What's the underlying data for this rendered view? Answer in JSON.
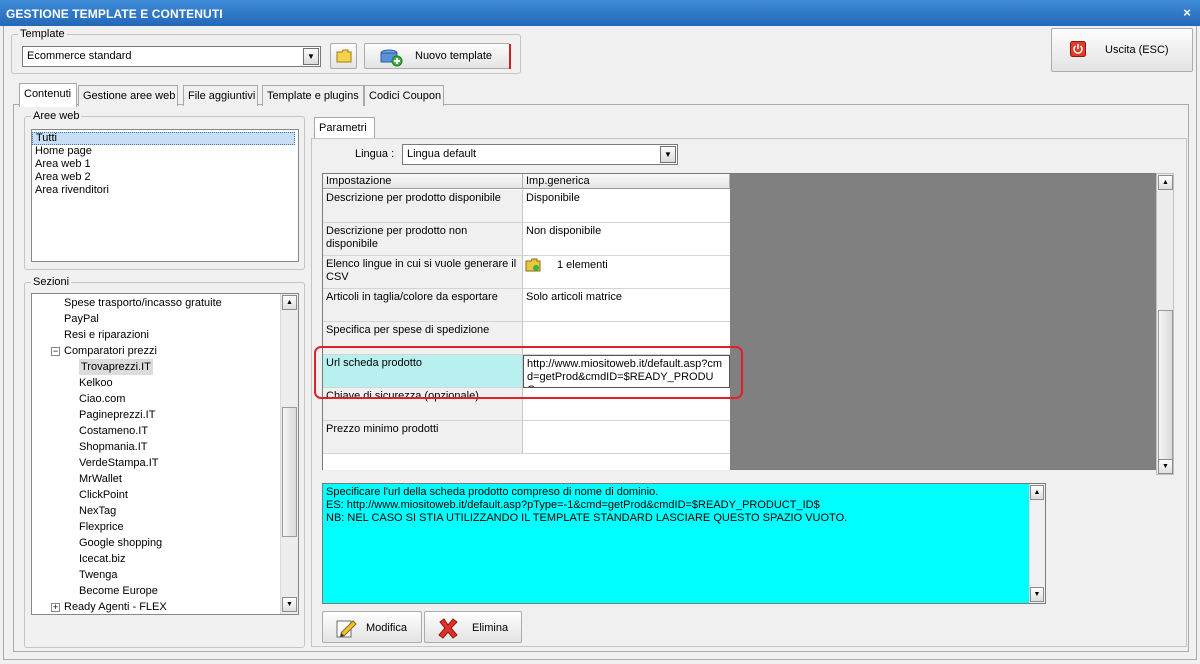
{
  "window": {
    "title": "GESTIONE TEMPLATE E CONTENUTI",
    "close_glyph": "×"
  },
  "template_group": {
    "legend": "Template",
    "selected": "Ecommerce standard",
    "new_button": "Nuovo template"
  },
  "exit_button": "Uscita (ESC)",
  "tabs": [
    "Contenuti",
    "Gestione aree web",
    "File aggiuntivi",
    "Template e plugins",
    "Codici Coupon"
  ],
  "aree_web": {
    "legend": "Aree web",
    "items": [
      "Tutti",
      "Home page",
      "Area web 1",
      "Area web 2",
      "Area rivenditori"
    ],
    "selected_index": 0
  },
  "sezioni": {
    "legend": "Sezioni",
    "items": [
      {
        "label": "Spese trasporto/incasso gratuite",
        "level": 1
      },
      {
        "label": "PayPal",
        "level": 1
      },
      {
        "label": "Resi e riparazioni",
        "level": 1
      },
      {
        "label": "Comparatori prezzi",
        "level": 1,
        "toggle": "−"
      },
      {
        "label": "Trovaprezzi.IT",
        "level": 2,
        "selected": true
      },
      {
        "label": "Kelkoo",
        "level": 2
      },
      {
        "label": "Ciao.com",
        "level": 2
      },
      {
        "label": "Pagineprezzi.IT",
        "level": 2
      },
      {
        "label": "Costameno.IT",
        "level": 2
      },
      {
        "label": "Shopmania.IT",
        "level": 2
      },
      {
        "label": "VerdeStampa.IT",
        "level": 2
      },
      {
        "label": "MrWallet",
        "level": 2
      },
      {
        "label": "ClickPoint",
        "level": 2
      },
      {
        "label": "NexTag",
        "level": 2
      },
      {
        "label": "Flexprice",
        "level": 2
      },
      {
        "label": "Google shopping",
        "level": 2
      },
      {
        "label": "Icecat.biz",
        "level": 2
      },
      {
        "label": "Twenga",
        "level": 2
      },
      {
        "label": "Become Europe",
        "level": 2
      },
      {
        "label": "Ready Agenti - FLEX",
        "level": 0,
        "toggle": "+"
      }
    ]
  },
  "parametri": {
    "tab": "Parametri",
    "lingua_label": "Lingua :",
    "lingua_value": "Lingua default",
    "columns": [
      "Impostazione",
      "Imp.generica"
    ],
    "rows": [
      {
        "setting": "Descrizione per prodotto disponibile",
        "value": "Disponibile"
      },
      {
        "setting": "Descrizione per prodotto non disponibile",
        "value": "Non disponibile"
      },
      {
        "setting": "Elenco lingue in cui si vuole generare il CSV",
        "value": "1 elementi"
      },
      {
        "setting": "Articoli in taglia/colore da esportare",
        "value": "Solo articoli matrice"
      },
      {
        "setting": "Specifica per spese di spedizione",
        "value": ""
      },
      {
        "setting": "Url scheda prodotto",
        "value": "http://www.miositoweb.it/default.asp?cmd=getProd&cmdID=$READY_PRODUC..."
      },
      {
        "setting": "Chiave di sicurezza (opzionale)",
        "value": ""
      },
      {
        "setting": "Prezzo minimo prodotti",
        "value": ""
      }
    ],
    "highlight_color": "#e0202a",
    "description": [
      "Specificare l'url della scheda prodotto compreso di nome di dominio.",
      "ES: http://www.miositoweb.it/default.asp?pType=-1&cmd=getProd&cmdID=$READY_PRODUCT_ID$",
      "NB: NEL CASO SI STIA UTILIZZANDO IL TEMPLATE STANDARD LASCIARE QUESTO SPAZIO VUOTO."
    ],
    "modifica": "Modifica",
    "elimina": "Elimina"
  },
  "icons": {
    "folder": "folder-icon",
    "new_template": "package-add-icon",
    "exit": "power-icon",
    "modify": "pencil-icon",
    "delete": "red-x-icon"
  },
  "colors": {
    "titlebar": "#2a6fc0",
    "description_bg": "#00ffff",
    "selected_row": "#b8f0f0"
  }
}
